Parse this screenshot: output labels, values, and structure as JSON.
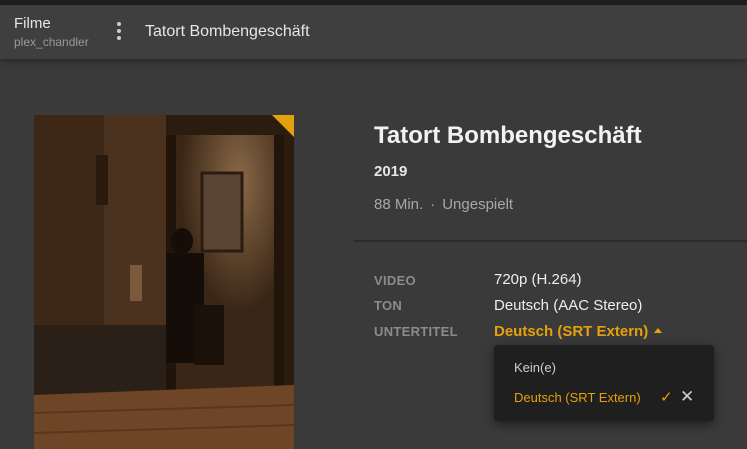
{
  "header": {
    "library_title": "Filme",
    "user": "plex_chandler",
    "breadcrumb_title": "Tatort Bombengeschäft"
  },
  "movie": {
    "title": "Tatort Bombengeschäft",
    "year": "2019",
    "duration": "88 Min.",
    "separator": "·",
    "status": "Ungespielt"
  },
  "media": {
    "video_label": "VIDEO",
    "video_value": "720p (H.264)",
    "audio_label": "TON",
    "audio_value": "Deutsch (AAC Stereo)",
    "subtitle_label": "UNTERTITEL",
    "subtitle_value": "Deutsch (SRT Extern)"
  },
  "subtitle_menu": {
    "options": [
      "Kein(e)",
      "Deutsch (SRT Extern)"
    ],
    "selected_index": 1,
    "check_icon": "check-icon",
    "clear_icon": "close-icon"
  },
  "colors": {
    "accent": "#e5a00d",
    "background": "#3a3a3a",
    "header": "#3f3f3f",
    "dropdown": "#1f1f1f"
  },
  "icons": [
    "more-vertical-icon",
    "check-icon",
    "close-icon",
    "caret-up-icon"
  ]
}
